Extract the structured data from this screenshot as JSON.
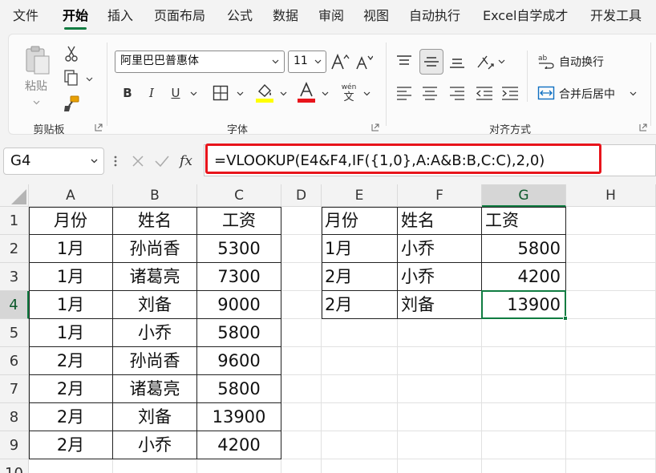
{
  "menu": {
    "tabs": [
      "文件",
      "开始",
      "插入",
      "页面布局",
      "公式",
      "数据",
      "审阅",
      "视图",
      "自动执行",
      "Excel自学成才",
      "开发工具"
    ],
    "active": "开始"
  },
  "ribbon": {
    "clipboard": {
      "paste_label": "粘贴",
      "group_label": "剪贴板"
    },
    "font": {
      "font_name": "阿里巴巴普惠体",
      "font_size": "11",
      "bold": "B",
      "italic": "I",
      "underline": "U",
      "wen_pinyin": "wén",
      "wen_char": "文",
      "group_label": "字体"
    },
    "alignment": {
      "wrap_text": "自动换行",
      "merge_center": "合并后居中",
      "group_label": "对齐方式"
    },
    "colors": {
      "highlight": "#ffff00",
      "font_color": "#e8141b",
      "accent": "#107c41"
    }
  },
  "formula_bar": {
    "name_box": "G4",
    "fx": "fx",
    "formula": "=VLOOKUP(E4&F4,IF({1,0},A:A&B:B,C:C),2,0)"
  },
  "grid": {
    "columns": [
      "A",
      "B",
      "C",
      "D",
      "E",
      "F",
      "G",
      "H"
    ],
    "rows": [
      "1",
      "2",
      "3",
      "4",
      "5",
      "6",
      "7",
      "8",
      "9",
      "10"
    ],
    "selected_cell": "G4",
    "left_table": [
      [
        "月份",
        "姓名",
        "工资"
      ],
      [
        "1月",
        "孙尚香",
        "5300"
      ],
      [
        "1月",
        "诸葛亮",
        "7300"
      ],
      [
        "1月",
        "刘备",
        "9000"
      ],
      [
        "1月",
        "小乔",
        "5800"
      ],
      [
        "2月",
        "孙尚香",
        "9600"
      ],
      [
        "2月",
        "诸葛亮",
        "5800"
      ],
      [
        "2月",
        "刘备",
        "13900"
      ],
      [
        "2月",
        "小乔",
        "4200"
      ]
    ],
    "right_table": [
      [
        "月份",
        "姓名",
        "工资"
      ],
      [
        "1月",
        "小乔",
        "5800"
      ],
      [
        "2月",
        "小乔",
        "4200"
      ],
      [
        "2月",
        "刘备",
        "13900"
      ]
    ]
  }
}
